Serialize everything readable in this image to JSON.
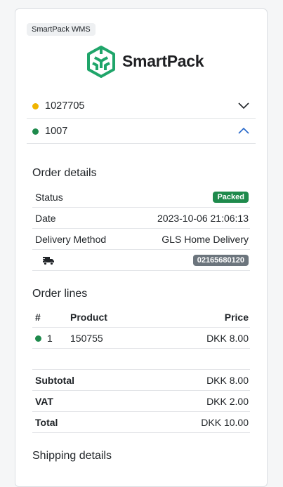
{
  "app": {
    "badge": "SmartPack WMS",
    "logo_text": "SmartPack"
  },
  "orders": [
    {
      "number": "1027705",
      "status_color": "#f0b400",
      "expanded": false
    },
    {
      "number": "1007",
      "status_color": "#1e8a4c",
      "expanded": true
    }
  ],
  "order_details": {
    "title": "Order details",
    "status_label": "Status",
    "status_value": "Packed",
    "date_label": "Date",
    "date_value": "2023-10-06 21:06:13",
    "delivery_label": "Delivery Method",
    "delivery_value": "GLS Home Delivery",
    "tracking_icon": "truck-icon",
    "tracking_number": "02165680120"
  },
  "order_lines": {
    "title": "Order lines",
    "headers": {
      "num": "#",
      "product": "Product",
      "price": "Price"
    },
    "rows": [
      {
        "num": "1",
        "product": "150755",
        "price": "DKK 8.00",
        "status_color": "#1e8a4c"
      }
    ]
  },
  "totals": {
    "subtotal_label": "Subtotal",
    "subtotal_value": "DKK 8.00",
    "vat_label": "VAT",
    "vat_value": "DKK 2.00",
    "total_label": "Total",
    "total_value": "DKK 10.00"
  },
  "shipping": {
    "title": "Shipping details"
  },
  "colors": {
    "accent_green": "#1e8a4c",
    "pending_yellow": "#f0b400",
    "badge_gray": "#6c757d"
  }
}
